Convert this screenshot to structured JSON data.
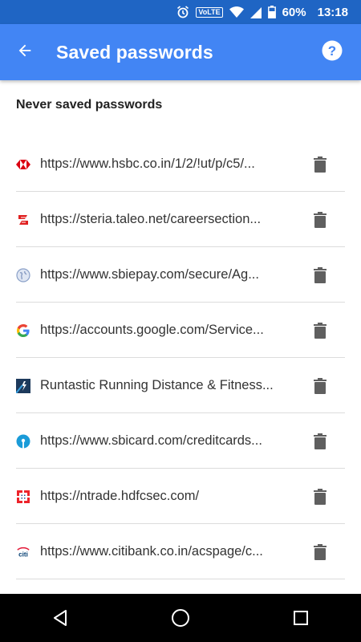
{
  "status_bar": {
    "alarm_icon": "alarm-icon",
    "volte": "VoLTE",
    "battery": "60%",
    "time": "13:18"
  },
  "app_bar": {
    "title": "Saved passwords",
    "back_icon": "arrow-back-icon",
    "help_icon": "help-icon"
  },
  "section": {
    "title": "Never saved passwords"
  },
  "items": [
    {
      "label": "https://www.hsbc.co.in/1/2/!ut/p/c5/...",
      "icon": "hsbc-favicon"
    },
    {
      "label": "https://steria.taleo.net/careersection...",
      "icon": "taleo-favicon"
    },
    {
      "label": "https://www.sbiepay.com/secure/Ag...",
      "icon": "globe-favicon"
    },
    {
      "label": "https://accounts.google.com/Service...",
      "icon": "google-favicon"
    },
    {
      "label": "Runtastic Running Distance & Fitness...",
      "icon": "runtastic-favicon"
    },
    {
      "label": "https://www.sbicard.com/creditcards...",
      "icon": "sbi-favicon"
    },
    {
      "label": "https://ntrade.hdfcsec.com/",
      "icon": "hdfc-favicon"
    },
    {
      "label": "https://www.citibank.co.in/acspage/c...",
      "icon": "citi-favicon"
    }
  ],
  "colors": {
    "status_bar": "#1f65c4",
    "app_bar": "#4285f4",
    "trash": "#5f5f5f"
  }
}
